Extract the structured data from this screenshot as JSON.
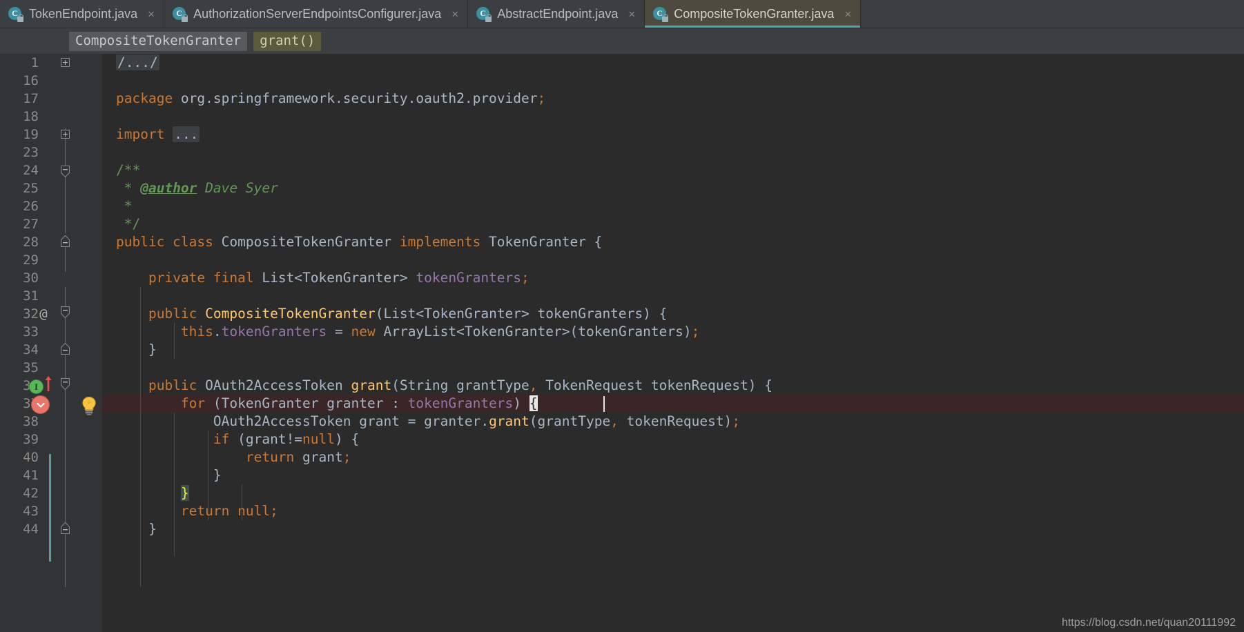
{
  "tabs": [
    {
      "label": "TokenEndpoint.java",
      "icon": "java-class-icon",
      "close": "×",
      "active": false
    },
    {
      "label": "AuthorizationServerEndpointsConfigurer.java",
      "icon": "java-class-icon",
      "close": "×",
      "active": false
    },
    {
      "label": "AbstractEndpoint.java",
      "icon": "java-class-icon",
      "close": "×",
      "active": false
    },
    {
      "label": "CompositeTokenGranter.java",
      "icon": "java-class-icon",
      "close": "×",
      "active": true
    }
  ],
  "breadcrumb": {
    "class": "CompositeTokenGranter",
    "method": "grant()"
  },
  "editor": {
    "line_numbers": [
      "1",
      "16",
      "17",
      "18",
      "19",
      "23",
      "24",
      "25",
      "26",
      "27",
      "28",
      "29",
      "30",
      "31",
      "32",
      "33",
      "34",
      "35",
      "36",
      "37",
      "38",
      "39",
      "40",
      "41",
      "42",
      "43",
      "44"
    ],
    "annotations": {
      "32": "@"
    },
    "code": {
      "l1_fold": "/.../",
      "l17": "package org.springframework.security.oauth2.provider;",
      "l19_kw": "import",
      "l19_fold": "...",
      "l24": "/**",
      "l25_star": "*",
      "l25_tag": "@author",
      "l25_name": "Dave Syer",
      "l26": "*",
      "l27": "*/",
      "l28": "public class CompositeTokenGranter implements TokenGranter {",
      "l30": "private final List<TokenGranter> tokenGranters;",
      "l32": "public CompositeTokenGranter(List<TokenGranter> tokenGranters) {",
      "l33": "this.tokenGranters = new ArrayList<TokenGranter>(tokenGranters);",
      "l34": "}",
      "l36": "public OAuth2AccessToken grant(String grantType, TokenRequest tokenRequest) {",
      "l37": "for (TokenGranter granter : tokenGranters) {",
      "l38": "OAuth2AccessToken grant = granter.grant(grantType, tokenRequest);",
      "l39": "if (grant!=null) {",
      "l40": "return grant;",
      "l41": "}",
      "l42": "}",
      "l43": "return null;",
      "l44": "}"
    },
    "gutter_markers": {
      "line36": "implementing-method-icon",
      "line36_arrow": "overridden-up-arrow-icon",
      "line37": "overriding-method-icon",
      "line37_bulb": "intention-bulb-icon"
    },
    "caret_line": "37",
    "matching_brace_lines": [
      "37",
      "42"
    ]
  },
  "watermark": "https://blog.csdn.net/quan20111992",
  "colors": {
    "background": "#2b2b2b",
    "gutter": "#313335",
    "tabbar": "#3c3f41",
    "active_tab": "#4e4a40",
    "accent": "#4aa5b5",
    "keyword": "#cc7832",
    "field": "#9876aa",
    "method": "#ffc66d",
    "comment": "#629755",
    "text": "#a9b7c6",
    "caret_line": "#3a2626",
    "change_bar": "#5f9e9e"
  }
}
